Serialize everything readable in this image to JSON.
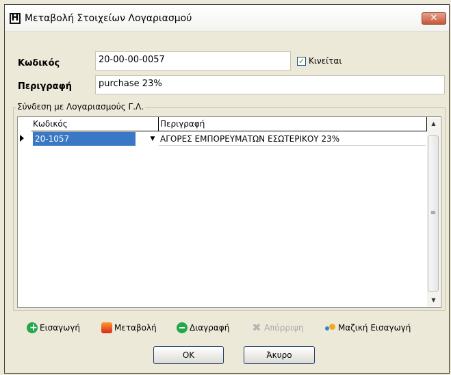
{
  "window": {
    "title": "Μεταβολή Στοιχείων Λογαριασμού",
    "app_icon_letter": "H",
    "close_glyph": "✕"
  },
  "form": {
    "code_label": "Κωδικός",
    "code_value": "20-00-00-0057",
    "active_label": "Κινείται",
    "active_checked": true,
    "description_label": "Περιγραφή",
    "description_value": "purchase 23%"
  },
  "group": {
    "title": "Σύνδεση με Λογαριασμούς Γ.Λ.",
    "grid": {
      "columns": [
        "Κωδικός",
        "Περιγραφή"
      ],
      "rows": [
        {
          "code": "20-1057",
          "description": "ΑΓΟΡΕΣ ΕΜΠΟΡΕΥΜΑΤΩΝ ΕΣΩΤΕΡΙΚΟΥ 23%"
        }
      ]
    }
  },
  "actions": [
    {
      "label": "Εισαγωγή",
      "icon": "add-icon",
      "enabled": true
    },
    {
      "label": "Μεταβολή",
      "icon": "edit-icon",
      "enabled": true
    },
    {
      "label": "Διαγραφή",
      "icon": "delete-icon",
      "enabled": true
    },
    {
      "label": "Απόρριψη",
      "icon": "reject-icon",
      "enabled": false
    },
    {
      "label": "Μαζική Εισαγωγή",
      "icon": "bulk-insert-icon",
      "enabled": true
    }
  ],
  "buttons": {
    "ok": "OK",
    "cancel": "Άκυρο"
  },
  "colors": {
    "selection": "#3a78c5",
    "close_button": "#c3583c"
  }
}
